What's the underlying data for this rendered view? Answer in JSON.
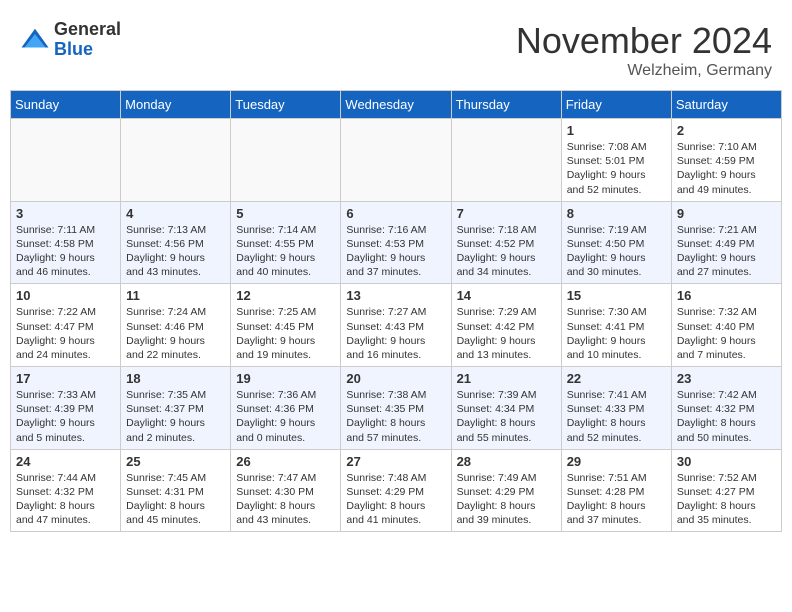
{
  "header": {
    "logo_general": "General",
    "logo_blue": "Blue",
    "month_title": "November 2024",
    "location": "Welzheim, Germany"
  },
  "days_of_week": [
    "Sunday",
    "Monday",
    "Tuesday",
    "Wednesday",
    "Thursday",
    "Friday",
    "Saturday"
  ],
  "weeks": [
    [
      {
        "day": "",
        "empty": true
      },
      {
        "day": "",
        "empty": true
      },
      {
        "day": "",
        "empty": true
      },
      {
        "day": "",
        "empty": true
      },
      {
        "day": "",
        "empty": true
      },
      {
        "day": "1",
        "sunrise": "7:08 AM",
        "sunset": "5:01 PM",
        "daylight": "9 hours and 52 minutes."
      },
      {
        "day": "2",
        "sunrise": "7:10 AM",
        "sunset": "4:59 PM",
        "daylight": "9 hours and 49 minutes."
      }
    ],
    [
      {
        "day": "3",
        "sunrise": "7:11 AM",
        "sunset": "4:58 PM",
        "daylight": "9 hours and 46 minutes."
      },
      {
        "day": "4",
        "sunrise": "7:13 AM",
        "sunset": "4:56 PM",
        "daylight": "9 hours and 43 minutes."
      },
      {
        "day": "5",
        "sunrise": "7:14 AM",
        "sunset": "4:55 PM",
        "daylight": "9 hours and 40 minutes."
      },
      {
        "day": "6",
        "sunrise": "7:16 AM",
        "sunset": "4:53 PM",
        "daylight": "9 hours and 37 minutes."
      },
      {
        "day": "7",
        "sunrise": "7:18 AM",
        "sunset": "4:52 PM",
        "daylight": "9 hours and 34 minutes."
      },
      {
        "day": "8",
        "sunrise": "7:19 AM",
        "sunset": "4:50 PM",
        "daylight": "9 hours and 30 minutes."
      },
      {
        "day": "9",
        "sunrise": "7:21 AM",
        "sunset": "4:49 PM",
        "daylight": "9 hours and 27 minutes."
      }
    ],
    [
      {
        "day": "10",
        "sunrise": "7:22 AM",
        "sunset": "4:47 PM",
        "daylight": "9 hours and 24 minutes."
      },
      {
        "day": "11",
        "sunrise": "7:24 AM",
        "sunset": "4:46 PM",
        "daylight": "9 hours and 22 minutes."
      },
      {
        "day": "12",
        "sunrise": "7:25 AM",
        "sunset": "4:45 PM",
        "daylight": "9 hours and 19 minutes."
      },
      {
        "day": "13",
        "sunrise": "7:27 AM",
        "sunset": "4:43 PM",
        "daylight": "9 hours and 16 minutes."
      },
      {
        "day": "14",
        "sunrise": "7:29 AM",
        "sunset": "4:42 PM",
        "daylight": "9 hours and 13 minutes."
      },
      {
        "day": "15",
        "sunrise": "7:30 AM",
        "sunset": "4:41 PM",
        "daylight": "9 hours and 10 minutes."
      },
      {
        "day": "16",
        "sunrise": "7:32 AM",
        "sunset": "4:40 PM",
        "daylight": "9 hours and 7 minutes."
      }
    ],
    [
      {
        "day": "17",
        "sunrise": "7:33 AM",
        "sunset": "4:39 PM",
        "daylight": "9 hours and 5 minutes."
      },
      {
        "day": "18",
        "sunrise": "7:35 AM",
        "sunset": "4:37 PM",
        "daylight": "9 hours and 2 minutes."
      },
      {
        "day": "19",
        "sunrise": "7:36 AM",
        "sunset": "4:36 PM",
        "daylight": "9 hours and 0 minutes."
      },
      {
        "day": "20",
        "sunrise": "7:38 AM",
        "sunset": "4:35 PM",
        "daylight": "8 hours and 57 minutes."
      },
      {
        "day": "21",
        "sunrise": "7:39 AM",
        "sunset": "4:34 PM",
        "daylight": "8 hours and 55 minutes."
      },
      {
        "day": "22",
        "sunrise": "7:41 AM",
        "sunset": "4:33 PM",
        "daylight": "8 hours and 52 minutes."
      },
      {
        "day": "23",
        "sunrise": "7:42 AM",
        "sunset": "4:32 PM",
        "daylight": "8 hours and 50 minutes."
      }
    ],
    [
      {
        "day": "24",
        "sunrise": "7:44 AM",
        "sunset": "4:32 PM",
        "daylight": "8 hours and 47 minutes."
      },
      {
        "day": "25",
        "sunrise": "7:45 AM",
        "sunset": "4:31 PM",
        "daylight": "8 hours and 45 minutes."
      },
      {
        "day": "26",
        "sunrise": "7:47 AM",
        "sunset": "4:30 PM",
        "daylight": "8 hours and 43 minutes."
      },
      {
        "day": "27",
        "sunrise": "7:48 AM",
        "sunset": "4:29 PM",
        "daylight": "8 hours and 41 minutes."
      },
      {
        "day": "28",
        "sunrise": "7:49 AM",
        "sunset": "4:29 PM",
        "daylight": "8 hours and 39 minutes."
      },
      {
        "day": "29",
        "sunrise": "7:51 AM",
        "sunset": "4:28 PM",
        "daylight": "8 hours and 37 minutes."
      },
      {
        "day": "30",
        "sunrise": "7:52 AM",
        "sunset": "4:27 PM",
        "daylight": "8 hours and 35 minutes."
      }
    ]
  ],
  "labels": {
    "sunrise": "Sunrise:",
    "sunset": "Sunset:",
    "daylight": "Daylight:"
  }
}
